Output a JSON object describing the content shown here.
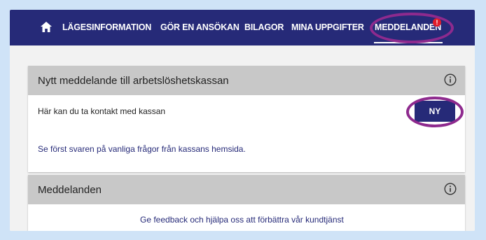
{
  "nav": {
    "items": [
      "LÄGESINFORMATION",
      "GÖR EN ANSÖKAN",
      "BILAGOR",
      "MINA UPPGIFTER",
      "MEDDELANDEN"
    ],
    "badge": "!",
    "active_index": 4
  },
  "new_message_card": {
    "title": "Nytt meddelande till arbetslöshetskassan",
    "contact_text": "Här kan du ta kontakt med kassan",
    "button_label": "NY",
    "faq_link": "Se först svaren på vanliga frågor från kassans hemsida."
  },
  "messages_card": {
    "title": "Meddelanden",
    "feedback_link": "Ge feedback och hjälpa oss att förbättra vår kundtjänst"
  },
  "colors": {
    "navbar": "#262a78",
    "highlight": "#8e2a8e",
    "badge": "#e01c2a",
    "header_gray": "#c8c8c8"
  },
  "icons": [
    "home-icon",
    "info-icon"
  ]
}
